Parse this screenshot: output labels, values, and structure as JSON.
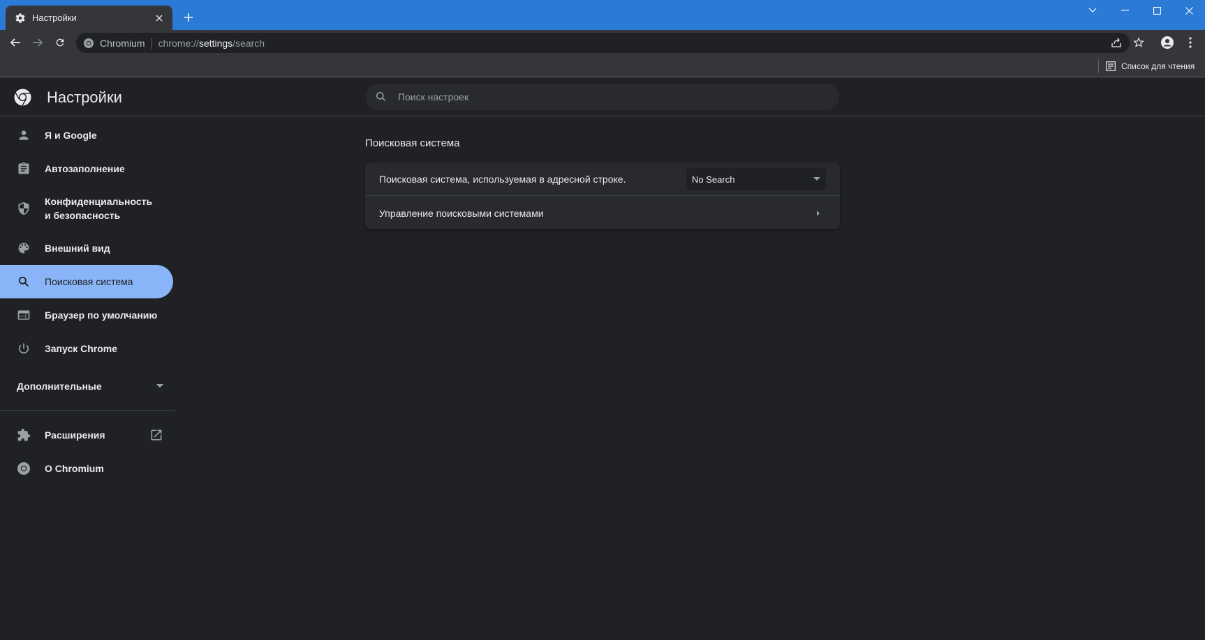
{
  "tab": {
    "title": "Настройки"
  },
  "omnibox": {
    "site_name": "Chromium",
    "url_prefix": "chrome://",
    "url_host": "settings",
    "url_path": "/search"
  },
  "bookmarks": {
    "reading_list_label": "Список для чтения"
  },
  "header": {
    "title": "Настройки",
    "search_placeholder": "Поиск настроек"
  },
  "sidebar": {
    "items": [
      {
        "label": "Я и Google",
        "icon": "person-icon"
      },
      {
        "label": "Автозаполнение",
        "icon": "clipboard-icon"
      },
      {
        "label": "Конфиденциальность и безопасность",
        "icon": "shield-icon"
      },
      {
        "label": "Внешний вид",
        "icon": "palette-icon"
      },
      {
        "label": "Поисковая система",
        "icon": "search-icon",
        "active": true
      },
      {
        "label": "Браузер по умолчанию",
        "icon": "browser-window-icon"
      },
      {
        "label": "Запуск Chrome",
        "icon": "power-icon"
      }
    ],
    "advanced_label": "Дополнительные",
    "extensions_label": "Расширения",
    "about_label": "О Chromium"
  },
  "main": {
    "section_title": "Поисковая система",
    "search_engine_row_label": "Поисковая система, используемая в адресной строке.",
    "search_engine_value": "No Search",
    "manage_row_label": "Управление поисковыми системами"
  },
  "colors": {
    "accent": "#8ab4f8",
    "titlebar": "#2a7ad6",
    "background": "#202124",
    "card": "#292a2d"
  }
}
